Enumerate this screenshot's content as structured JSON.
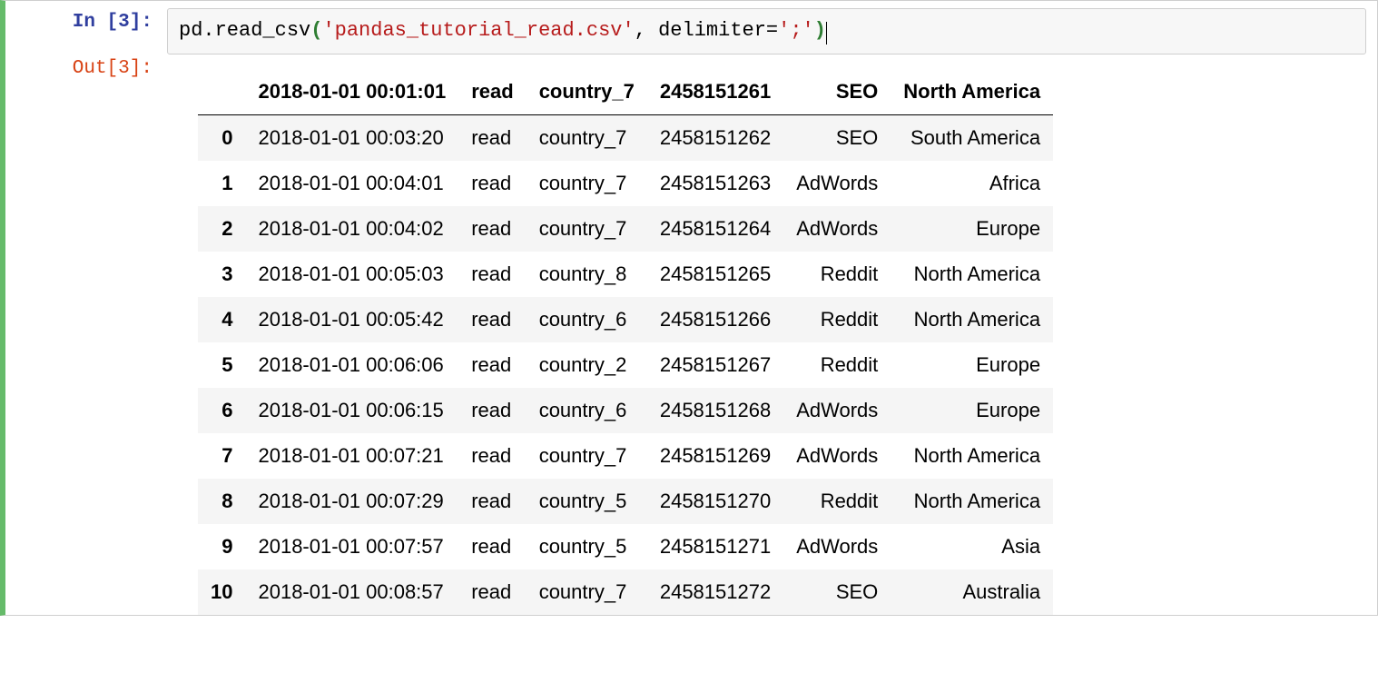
{
  "prompt": {
    "in_prefix": "In [",
    "in_num": "3",
    "in_suffix": "]:",
    "out_prefix": "Out[",
    "out_num": "3",
    "out_suffix": "]:"
  },
  "code": {
    "t1": "pd",
    "t2": ".",
    "t3": "read_csv",
    "t4": "(",
    "t5": "'pandas_tutorial_read.csv'",
    "t6": ", delimiter=",
    "t7": "';'",
    "t8": ")"
  },
  "dataframe": {
    "columns": [
      "2018-01-01 00:01:01",
      "read",
      "country_7",
      "2458151261",
      "SEO",
      "North America"
    ],
    "rows": [
      {
        "idx": "0",
        "c": [
          "2018-01-01 00:03:20",
          "read",
          "country_7",
          "2458151262",
          "SEO",
          "South America"
        ]
      },
      {
        "idx": "1",
        "c": [
          "2018-01-01 00:04:01",
          "read",
          "country_7",
          "2458151263",
          "AdWords",
          "Africa"
        ]
      },
      {
        "idx": "2",
        "c": [
          "2018-01-01 00:04:02",
          "read",
          "country_7",
          "2458151264",
          "AdWords",
          "Europe"
        ]
      },
      {
        "idx": "3",
        "c": [
          "2018-01-01 00:05:03",
          "read",
          "country_8",
          "2458151265",
          "Reddit",
          "North America"
        ]
      },
      {
        "idx": "4",
        "c": [
          "2018-01-01 00:05:42",
          "read",
          "country_6",
          "2458151266",
          "Reddit",
          "North America"
        ]
      },
      {
        "idx": "5",
        "c": [
          "2018-01-01 00:06:06",
          "read",
          "country_2",
          "2458151267",
          "Reddit",
          "Europe"
        ]
      },
      {
        "idx": "6",
        "c": [
          "2018-01-01 00:06:15",
          "read",
          "country_6",
          "2458151268",
          "AdWords",
          "Europe"
        ]
      },
      {
        "idx": "7",
        "c": [
          "2018-01-01 00:07:21",
          "read",
          "country_7",
          "2458151269",
          "AdWords",
          "North America"
        ]
      },
      {
        "idx": "8",
        "c": [
          "2018-01-01 00:07:29",
          "read",
          "country_5",
          "2458151270",
          "Reddit",
          "North America"
        ]
      },
      {
        "idx": "9",
        "c": [
          "2018-01-01 00:07:57",
          "read",
          "country_5",
          "2458151271",
          "AdWords",
          "Asia"
        ]
      },
      {
        "idx": "10",
        "c": [
          "2018-01-01 00:08:57",
          "read",
          "country_7",
          "2458151272",
          "SEO",
          "Australia"
        ]
      }
    ]
  }
}
